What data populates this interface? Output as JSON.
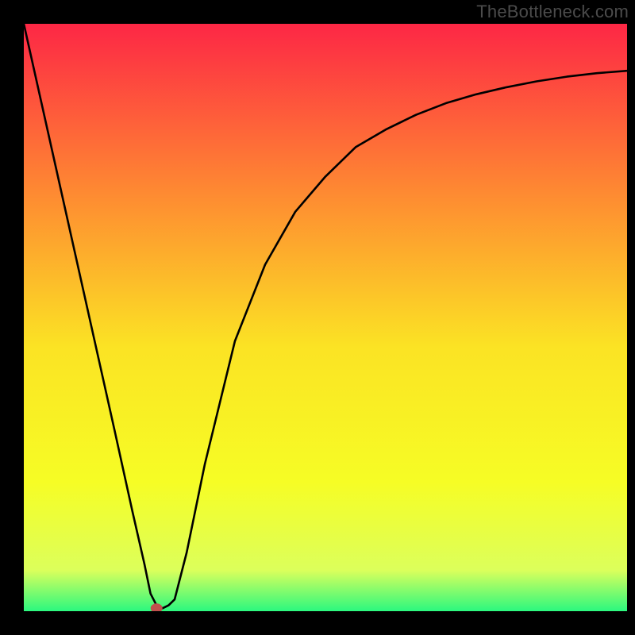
{
  "watermark": "TheBottleneck.com",
  "chart_data": {
    "type": "line",
    "title": "",
    "xlabel": "",
    "ylabel": "",
    "xlim": [
      0,
      100
    ],
    "ylim": [
      0,
      100
    ],
    "grid": false,
    "legend": false,
    "background_gradient": {
      "top": "#fd2745",
      "upper_mid": "#fe8e31",
      "mid": "#fbe324",
      "lower_mid": "#f6fd25",
      "near_bottom": "#dcff5b",
      "bottom": "#2bf87f"
    },
    "series": [
      {
        "name": "bottleneck-curve",
        "color": "#000000",
        "x": [
          0,
          5,
          10,
          15,
          18,
          20,
          21,
          22,
          23,
          24,
          25,
          27,
          30,
          35,
          40,
          45,
          50,
          55,
          60,
          65,
          70,
          75,
          80,
          85,
          90,
          95,
          100
        ],
        "y": [
          100,
          77,
          54,
          31,
          17,
          8,
          3,
          1,
          0.5,
          1,
          2,
          10,
          25,
          46,
          59,
          68,
          74,
          79,
          82,
          84.5,
          86.5,
          88,
          89.2,
          90.2,
          91,
          91.6,
          92
        ]
      }
    ],
    "marker": {
      "name": "optimal-point",
      "x": 22,
      "y": 0.5,
      "color": "#c0504d",
      "shape": "ellipse"
    }
  }
}
